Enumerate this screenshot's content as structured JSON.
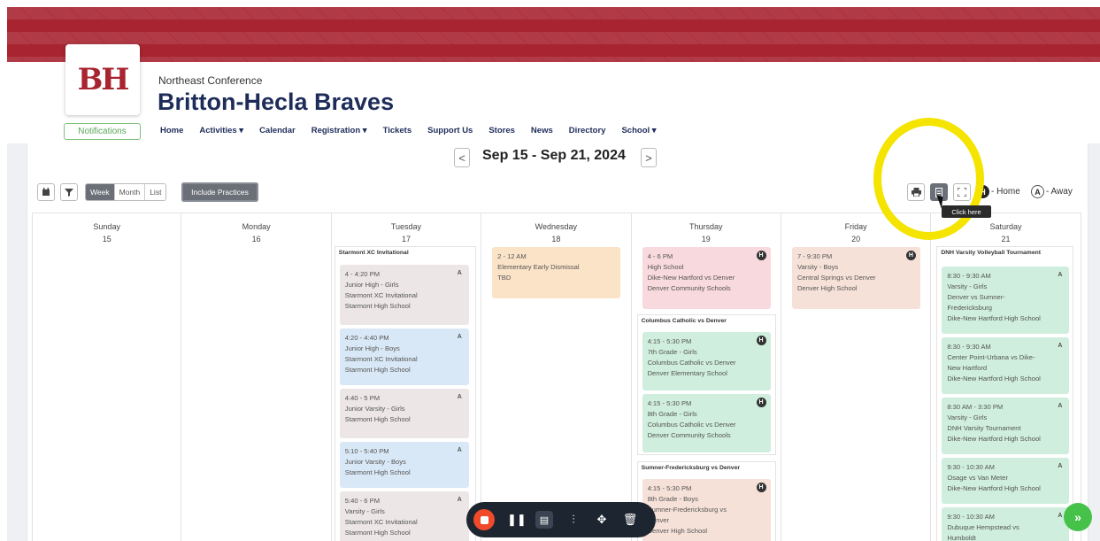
{
  "header": {
    "conference": "Northeast Conference",
    "team_name": "Britton-Hecla Braves",
    "logo_text": "BH",
    "notifications_label": "Notifications",
    "nav": [
      "Home",
      "Activities ▾",
      "Calendar",
      "Registration ▾",
      "Tickets",
      "Support Us",
      "Stores",
      "News",
      "Directory",
      "School ▾"
    ]
  },
  "calendar": {
    "date_range": "Sep 15 - Sep 21, 2024",
    "prev_icon": "<",
    "next_icon": ">",
    "views": [
      "Week",
      "Month",
      "List"
    ],
    "active_view": "Week",
    "include_practices": "Include Practices",
    "legend_home": "- Home",
    "legend_away": "- Away",
    "legend_home_letter": "H",
    "legend_away_letter": "A",
    "tooltip": "Click here"
  },
  "days": [
    {
      "name": "Sunday",
      "num": "15"
    },
    {
      "name": "Monday",
      "num": "16"
    },
    {
      "name": "Tuesday",
      "num": "17"
    },
    {
      "name": "Wednesday",
      "num": "18"
    },
    {
      "name": "Thursday",
      "num": "19"
    },
    {
      "name": "Friday",
      "num": "20"
    },
    {
      "name": "Saturday",
      "num": "21"
    }
  ],
  "groups": {
    "tue": "Starmont XC Invitational",
    "thu1": "Columbus Catholic vs Denver",
    "thu2": "Sumner-Fredericksburg vs Denver",
    "sat": "DNH Varsity Volleyball Tournament"
  },
  "events": {
    "tue1": {
      "lines": [
        "4 - 4:20 PM",
        "Junior High - Girls",
        "Starmont XC Invitational",
        "Starmont High School"
      ],
      "badge": "A"
    },
    "tue2": {
      "lines": [
        "4:20 - 4:40 PM",
        "Junior High - Boys",
        "Starmont XC Invitational",
        "Starmont High School"
      ],
      "badge": "A"
    },
    "tue3": {
      "lines": [
        "4:40 - 5 PM",
        "Junior Varsity - Girls",
        "Starmont High School"
      ],
      "badge": "A"
    },
    "tue4": {
      "lines": [
        "5:10 - 5:40 PM",
        "Junior Varsity - Boys",
        "Starmont High School"
      ],
      "badge": "A"
    },
    "tue5": {
      "lines": [
        "5:40 - 6 PM",
        "Varsity - Girls",
        "Starmont XC Invitational",
        "Starmont High School"
      ],
      "badge": "A"
    },
    "wed1": {
      "lines": [
        "2 - 12 AM",
        "Elementary Early Dismissal",
        "TBD"
      ],
      "badge": ""
    },
    "thu1": {
      "lines": [
        "4 - 6 PM",
        "High School",
        "Dike-New Hartford vs Denver",
        "Denver Community Schools"
      ],
      "badge": "H"
    },
    "thu2": {
      "lines": [
        "4:15 - 5:30 PM",
        "7th Grade - Girls",
        "Columbus Catholic vs Denver",
        "Denver Elementary School"
      ],
      "badge": "H"
    },
    "thu3": {
      "lines": [
        "4:15 - 5:30 PM",
        "8th Grade - Girls",
        "Columbus Catholic vs Denver",
        "Denver Community Schools"
      ],
      "badge": "H"
    },
    "thu4": {
      "lines": [
        "4:15 - 5:30 PM",
        "8th Grade - Boys",
        "Sumner-Fredericksburg vs",
        "Denver",
        "Denver High School"
      ],
      "badge": "H"
    },
    "fri1": {
      "lines": [
        "7 - 9:30 PM",
        "Varsity - Boys",
        "Central Springs vs Denver",
        "Denver High School"
      ],
      "badge": "H"
    },
    "sat1": {
      "lines": [
        "8:30 - 9:30 AM",
        "Varsity - Girls",
        "Denver vs Sumner-",
        "Fredericksburg",
        "Dike-New Hartford High School"
      ],
      "badge": "A"
    },
    "sat2": {
      "lines": [
        "8:30 - 9:30 AM",
        "Center Point-Urbana vs Dike-",
        "New Hartford",
        "Dike-New Hartford High School"
      ],
      "badge": "A"
    },
    "sat3": {
      "lines": [
        "8:30 AM - 3:30 PM",
        "Varsity - Girls",
        "DNH Varsity Tournament",
        "Dike-New Hartford High School"
      ],
      "badge": "A"
    },
    "sat4": {
      "lines": [
        "9:30 - 10:30 AM",
        "Osage vs Van Meter",
        "Dike-New Hartford High School"
      ],
      "badge": "A"
    },
    "sat5": {
      "lines": [
        "9:30 - 10:30 AM",
        "Dubuque Hempstead vs",
        "Humboldt"
      ],
      "badge": "A"
    }
  },
  "colors": {
    "banner": "#a72430",
    "brand_navy": "#1e2c5a",
    "highlight_ring": "#f5e400",
    "record_red": "#ef4a2a",
    "fab_green": "#46c24a"
  }
}
